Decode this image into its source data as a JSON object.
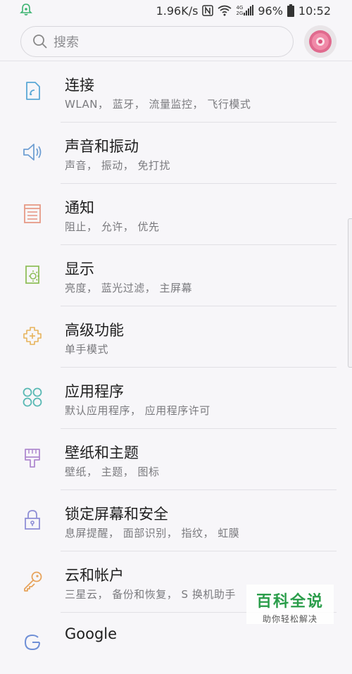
{
  "status_bar": {
    "network_speed": "1.96K/s",
    "nfc": "N",
    "sig_4g": "4G",
    "sig_2g": "2G",
    "battery": "96%",
    "time": "10:52"
  },
  "search": {
    "placeholder": "搜索"
  },
  "settings": [
    {
      "title": "连接",
      "subtitle": "WLAN， 蓝牙， 流量监控， 飞行模式",
      "icon": "connection-icon",
      "color": "#5aa8d6"
    },
    {
      "title": "声音和振动",
      "subtitle": "声音， 振动， 免打扰",
      "icon": "speaker-icon",
      "color": "#6f9fd3"
    },
    {
      "title": "通知",
      "subtitle": "阻止， 允许， 优先",
      "icon": "notification-icon",
      "color": "#e79a86"
    },
    {
      "title": "显示",
      "subtitle": "亮度， 蓝光过滤， 主屏幕",
      "icon": "display-icon",
      "color": "#8fbf5a"
    },
    {
      "title": "高级功能",
      "subtitle": "单手模式",
      "icon": "advanced-features-icon",
      "color": "#e7b35b"
    },
    {
      "title": "应用程序",
      "subtitle": "默认应用程序， 应用程序许可",
      "icon": "apps-icon",
      "color": "#59b9b4"
    },
    {
      "title": "壁纸和主题",
      "subtitle": "壁纸， 主题， 图标",
      "icon": "wallpaper-brush-icon",
      "color": "#b08ad0"
    },
    {
      "title": "锁定屏幕和安全",
      "subtitle": "息屏提醒， 面部识别， 指纹， 虹膜",
      "icon": "lock-icon",
      "color": "#8f8fd6"
    },
    {
      "title": "云和帐户",
      "subtitle": "三星云， 备份和恢复， S 换机助手",
      "icon": "key-icon",
      "color": "#e7a35b"
    },
    {
      "title": "Google",
      "subtitle": "",
      "icon": "google-icon",
      "color": "#6f8fd6"
    }
  ],
  "watermark": {
    "title": "百科全说",
    "subtitle": "助你轻松解决"
  }
}
